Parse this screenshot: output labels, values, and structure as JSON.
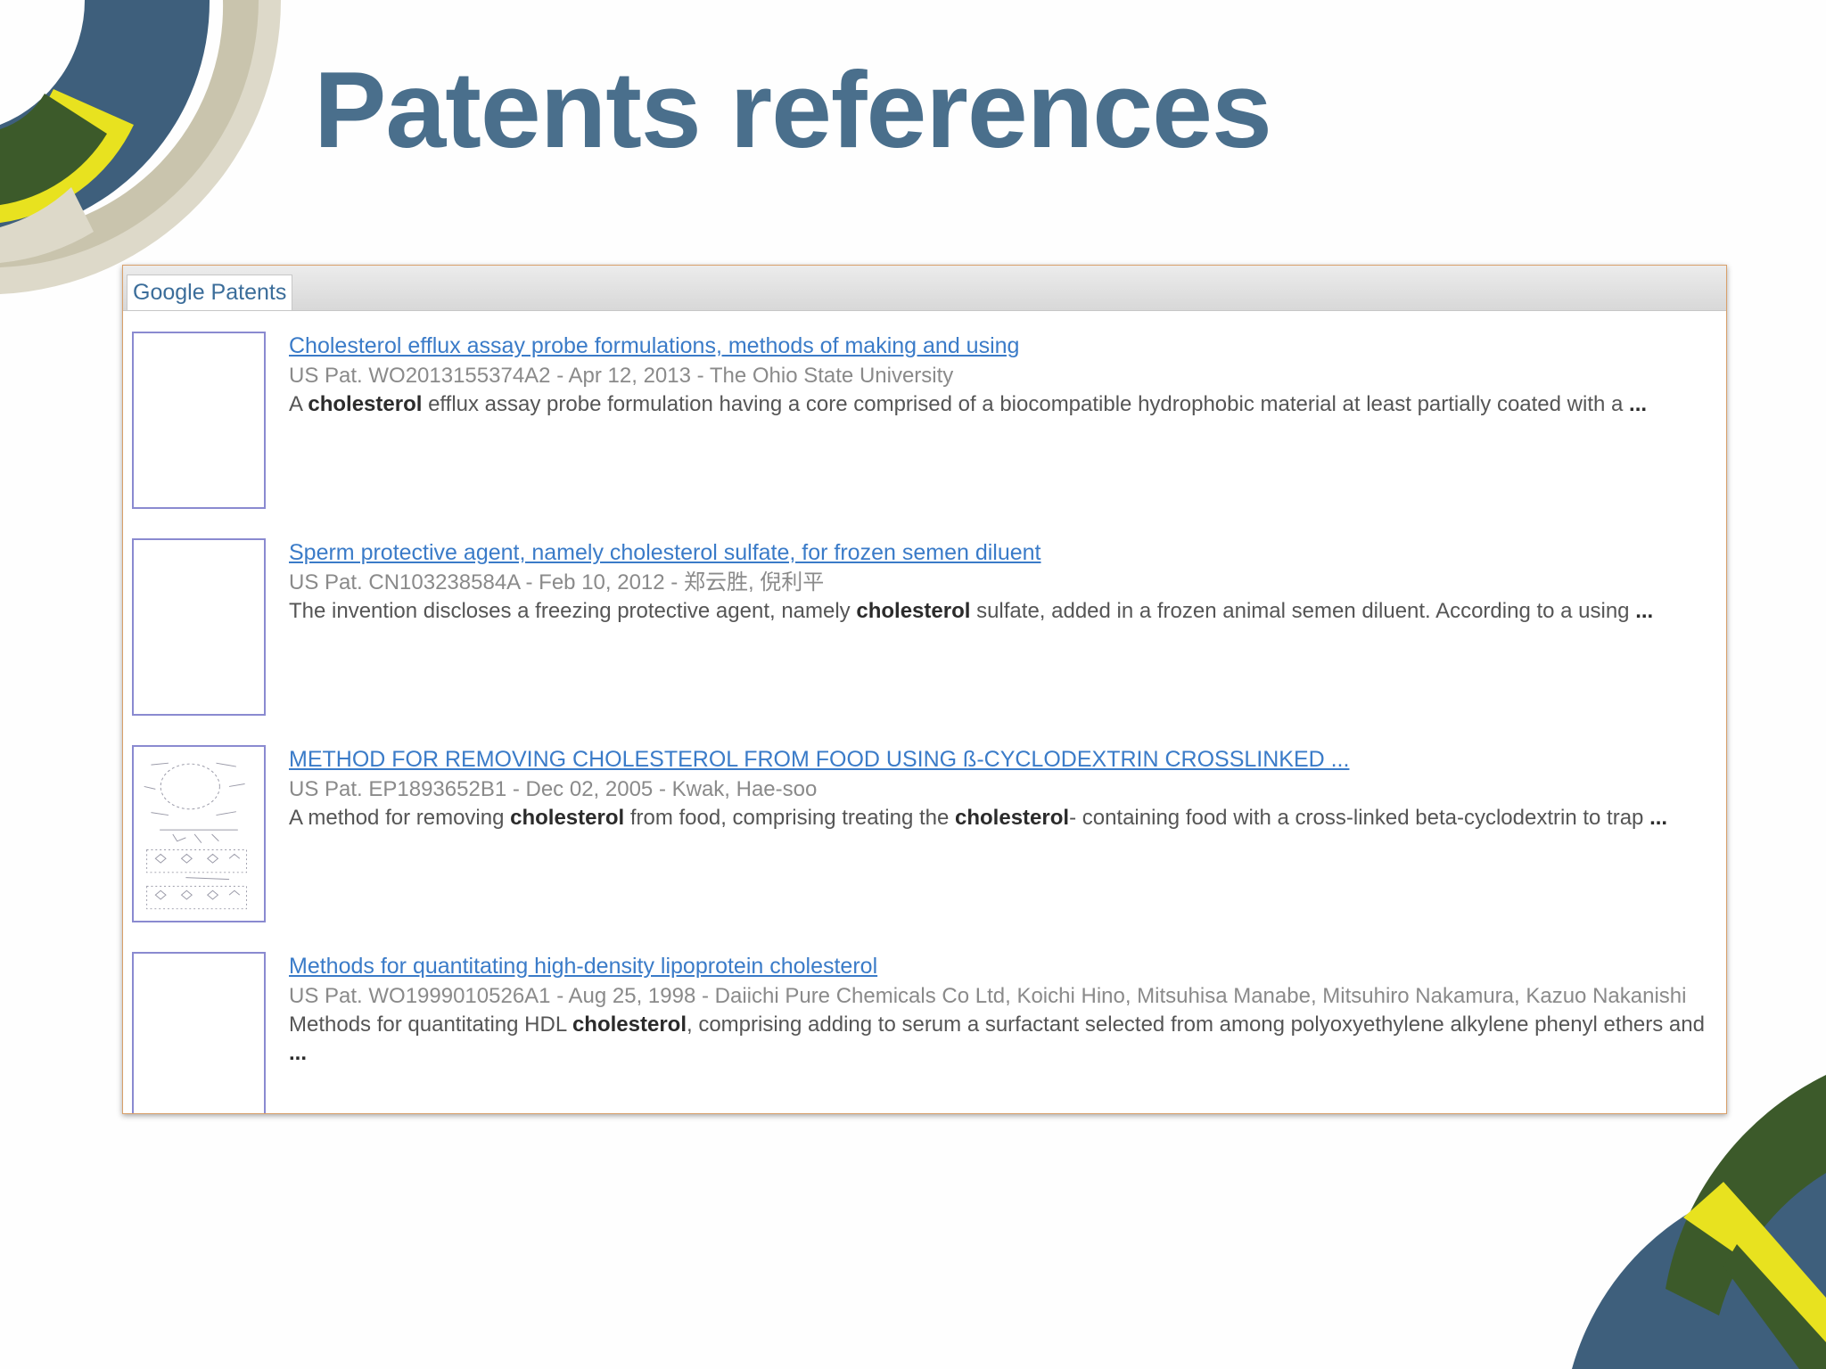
{
  "slide": {
    "title": "Patents references"
  },
  "colors": {
    "title": "#4a6f8c",
    "link": "#3a7bc8",
    "deco_blue": "#3e5f7c",
    "deco_green": "#3c5a2a",
    "deco_yellow": "#e8e21f",
    "deco_tan": "#c9c4ad"
  },
  "widget": {
    "tab_label": "Google Patents",
    "results": [
      {
        "title": "Cholesterol efflux assay probe formulations, methods of making and using",
        "meta": "US Pat. WO2013155374A2 - Apr 12, 2013 - The Ohio State University",
        "snippet_parts": [
          "A ",
          "cholesterol",
          " efflux assay probe formulation having a core comprised of a biocompatible hydrophobic material at least partially coated with a ",
          "..."
        ],
        "thumbnail": "blank"
      },
      {
        "title": "Sperm protective agent, namely cholesterol sulfate, for frozen semen diluent",
        "meta": "US Pat. CN103238584A - Feb 10, 2012 - 郑云胜, 倪利平",
        "snippet_parts": [
          "The invention discloses a freezing protective agent, namely ",
          "cholesterol",
          " sulfate, added in a frozen animal semen diluent. According to a using ",
          "..."
        ],
        "thumbnail": "blank"
      },
      {
        "title": "METHOD FOR REMOVING CHOLESTEROL FROM FOOD USING ß-CYCLODEXTRIN CROSSLINKED ...",
        "meta": "US Pat. EP1893652B1 - Dec 02, 2005 - Kwak, Hae-soo",
        "snippet_parts": [
          "A method for removing ",
          "cholesterol",
          " from food, comprising treating the ",
          "cholesterol",
          "- containing food with a cross-linked beta-cyclodextrin to trap ",
          "..."
        ],
        "thumbnail": "chemical-diagram"
      },
      {
        "title": "Methods for quantitating high-density lipoprotein cholesterol",
        "meta": "US Pat. WO1999010526A1 - Aug 25, 1998 - Daiichi Pure Chemicals Co Ltd, Koichi Hino, Mitsuhisa Manabe, Mitsuhiro Nakamura, Kazuo Nakanishi",
        "snippet_parts": [
          "Methods for quantitating HDL ",
          "cholesterol",
          ", comprising adding to serum a surfactant selected from among polyoxyethylene alkylene phenyl ethers and ",
          "..."
        ],
        "thumbnail": "blank"
      }
    ]
  }
}
